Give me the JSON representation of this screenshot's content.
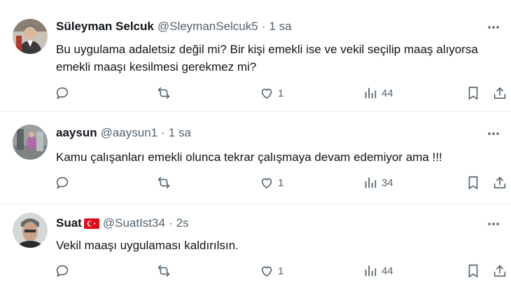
{
  "tweets": [
    {
      "name": "Süleyman Selcuk",
      "handle": "@SleymanSelcuk5",
      "separator": "·",
      "time": "1 sa",
      "text": "Bu uygulama adaletsiz değil mi? Bir kişi emekli ise ve vekil seçilip maaş alıyorsa emekli maaşı kesilmesi gerekmez mi?",
      "likes": "1",
      "views": "44",
      "flag": false
    },
    {
      "name": "aaysun",
      "handle": "@aaysun1",
      "separator": "·",
      "time": "1 sa",
      "text": "Kamu çalışanları emekli olunca tekrar çalışmaya devam edemiyor ama !!!",
      "likes": "1",
      "views": "34",
      "flag": false
    },
    {
      "name": "Suat",
      "handle": "@SuatIst34",
      "separator": "·",
      "time": "2s",
      "text": "Vekil maaşı uygulaması kaldırılsın.",
      "likes": "1",
      "views": "44",
      "flag": true
    }
  ],
  "icons": {
    "more": "more-horizontal-icon",
    "reply": "reply-icon",
    "retweet": "retweet-icon",
    "like": "heart-icon",
    "views": "views-chart-icon",
    "bookmark": "bookmark-icon",
    "share": "share-icon"
  },
  "colors": {
    "text": "#0f1419",
    "secondary": "#536471",
    "divider": "#eff3f4",
    "flag_red": "#e30a17"
  }
}
